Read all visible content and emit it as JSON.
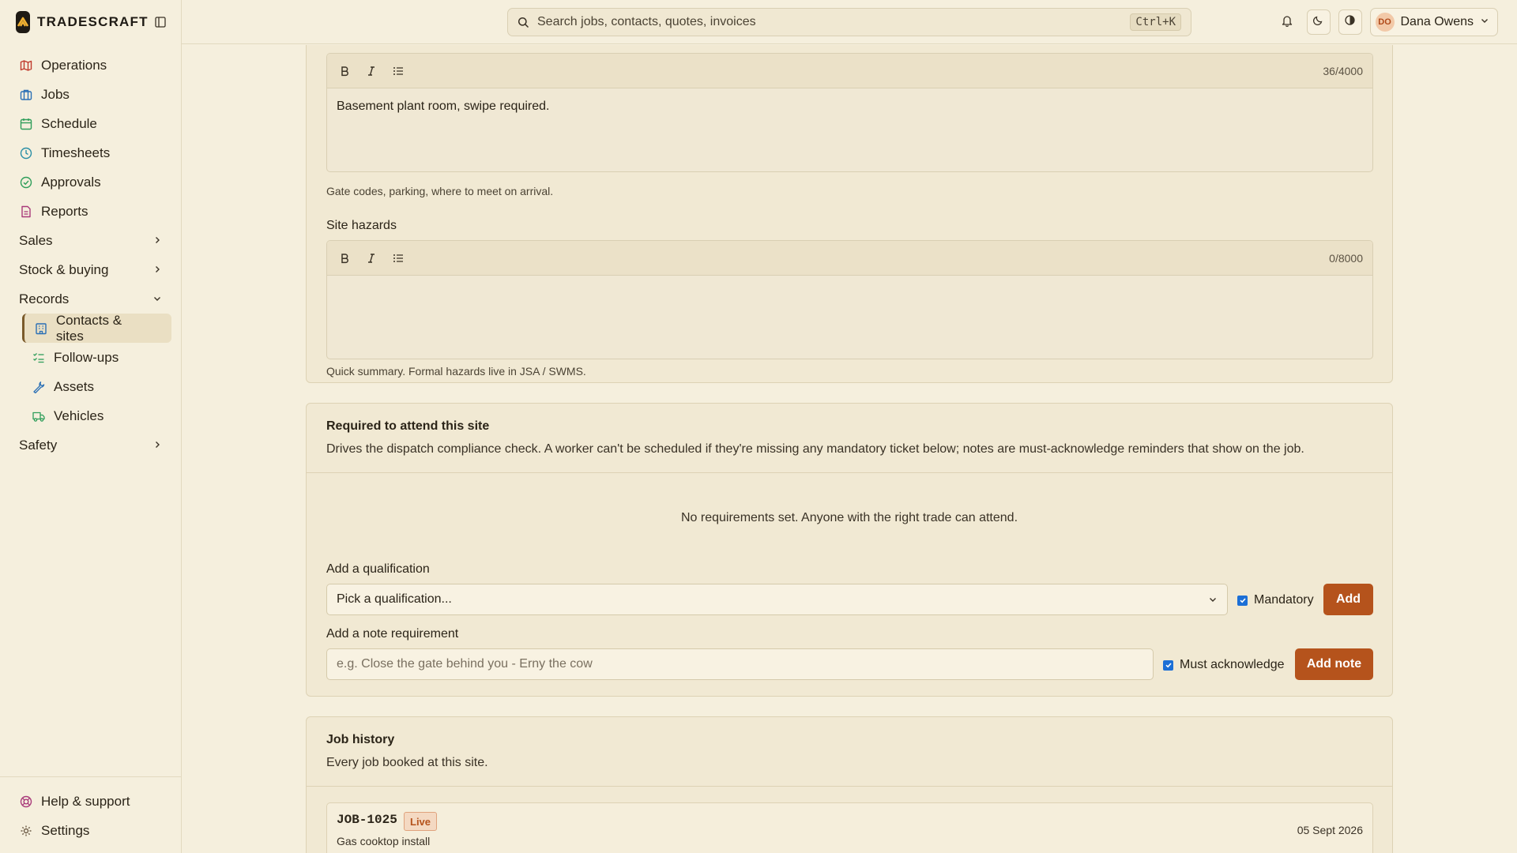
{
  "brand": {
    "name": "TRADESCRAFT"
  },
  "search": {
    "placeholder": "Search jobs, contacts, quotes, invoices",
    "shortcut": "Ctrl+K"
  },
  "user": {
    "initials": "DO",
    "name": "Dana Owens"
  },
  "sidebar": {
    "items": [
      {
        "label": "Operations",
        "icon": "map-icon",
        "color": "#c0392b"
      },
      {
        "label": "Jobs",
        "icon": "briefcase-icon",
        "color": "#2a6fb5"
      },
      {
        "label": "Schedule",
        "icon": "calendar-icon",
        "color": "#2f9e5a"
      },
      {
        "label": "Timesheets",
        "icon": "clock-icon",
        "color": "#2a8fa6"
      },
      {
        "label": "Approvals",
        "icon": "check-circle-icon",
        "color": "#2f9e5a"
      },
      {
        "label": "Reports",
        "icon": "file-icon",
        "color": "#a93a7a"
      }
    ],
    "groups": [
      {
        "label": "Sales"
      },
      {
        "label": "Stock & buying"
      },
      {
        "label": "Records"
      }
    ],
    "records_items": [
      {
        "label": "Contacts & sites",
        "icon": "building-icon",
        "color": "#2a6fb5"
      },
      {
        "label": "Follow-ups",
        "icon": "list-check-icon",
        "color": "#2f9e5a"
      },
      {
        "label": "Assets",
        "icon": "wrench-icon",
        "color": "#2a6fb5"
      },
      {
        "label": "Vehicles",
        "icon": "truck-icon",
        "color": "#2f9e5a"
      }
    ],
    "safety": {
      "label": "Safety"
    },
    "footer": [
      {
        "label": "Help & support",
        "icon": "lifebuoy-icon",
        "color": "#a93a7a"
      },
      {
        "label": "Settings",
        "icon": "gear-icon",
        "color": "#6b5a44"
      }
    ]
  },
  "site_notes": {
    "access_counter": "36/4000",
    "access_text": "Basement plant room, swipe required.",
    "access_helper": "Gate codes, parking, where to meet on arrival.",
    "hazards_label": "Site hazards",
    "hazards_counter": "0/8000",
    "hazards_helper": "Quick summary. Formal hazards live in JSA / SWMS."
  },
  "requirements": {
    "title": "Required to attend this site",
    "description": "Drives the dispatch compliance check. A worker can't be scheduled if they're missing any mandatory ticket below; notes are must-acknowledge reminders that show on the job.",
    "empty": "No requirements set. Anyone with the right trade can attend.",
    "qual_label": "Add a qualification",
    "qual_placeholder": "Pick a qualification...",
    "mandatory_label": "Mandatory",
    "add_label": "Add",
    "note_label": "Add a note requirement",
    "note_placeholder": "e.g. Close the gate behind you - Erny the cow",
    "ack_label": "Must acknowledge",
    "add_note_label": "Add note"
  },
  "job_history": {
    "title": "Job history",
    "description": "Every job booked at this site.",
    "jobs": [
      {
        "id": "JOB-1025",
        "status": "Live",
        "desc": "Gas cooktop install",
        "date": "05 Sept 2026"
      }
    ]
  },
  "colors": {
    "accent": "#b5531c",
    "background": "#f5efdd"
  }
}
